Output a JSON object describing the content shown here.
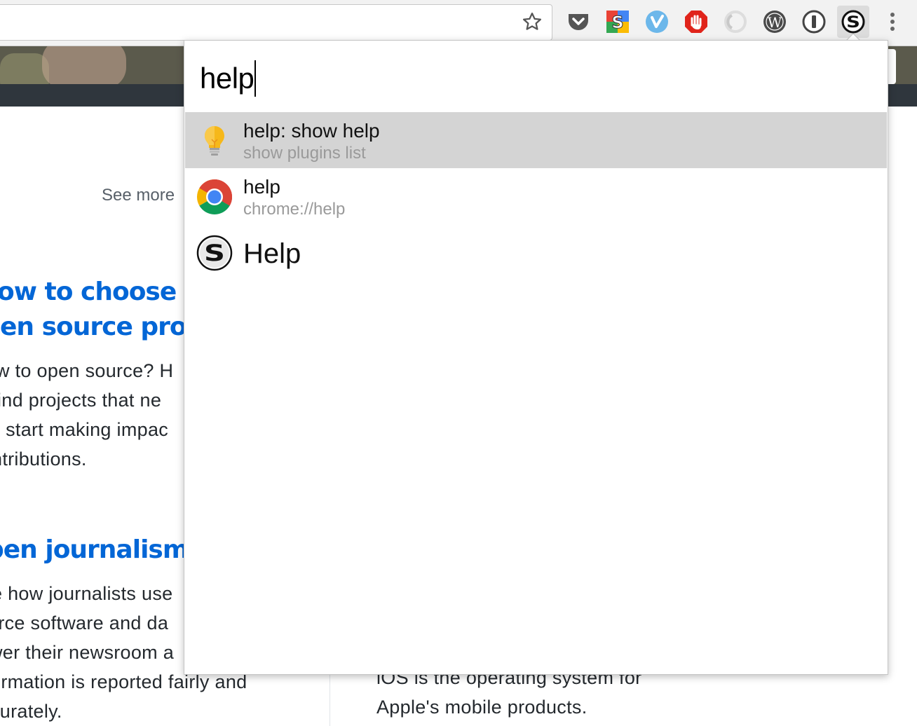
{
  "browser": {
    "icons": {
      "bookmark": "star-icon",
      "extensions": [
        "pocket-icon",
        "sortd-icon",
        "vue-icon",
        "adblock-hand-icon",
        "ghostery-icon",
        "wordpress-icon",
        "onepassword-icon",
        "saka-icon"
      ],
      "menu": "kebab-menu-icon"
    }
  },
  "page": {
    "see_more": "See more",
    "article1": {
      "title_line1": "ow to choose yo",
      "title_line2": "en source proje",
      "lines": [
        "w to open source? H",
        "ind projects that ne",
        "l start making impac",
        "ntributions."
      ]
    },
    "article2": {
      "title": "pen journalism",
      "lines": [
        "e how journalists use",
        "urce software and da",
        "wer their newsroom a",
        "ormation is reported fairly and",
        "curately."
      ]
    },
    "article3": {
      "lines": [
        "iOS is the operating system for",
        "Apple's mobile products."
      ]
    }
  },
  "popup": {
    "query": "help",
    "results": [
      {
        "icon": "lightbulb-icon",
        "title": "help: show help",
        "subtitle": "show plugins list",
        "selected": true
      },
      {
        "icon": "chrome-icon",
        "title": "help",
        "subtitle": "chrome://help",
        "selected": false
      },
      {
        "icon": "saka-icon",
        "title": "Help",
        "subtitle": "",
        "selected": false
      }
    ]
  },
  "colors": {
    "link_blue": "#0366d6",
    "selected_row": "#d4d4d4",
    "dark_band": "#2f363d"
  }
}
